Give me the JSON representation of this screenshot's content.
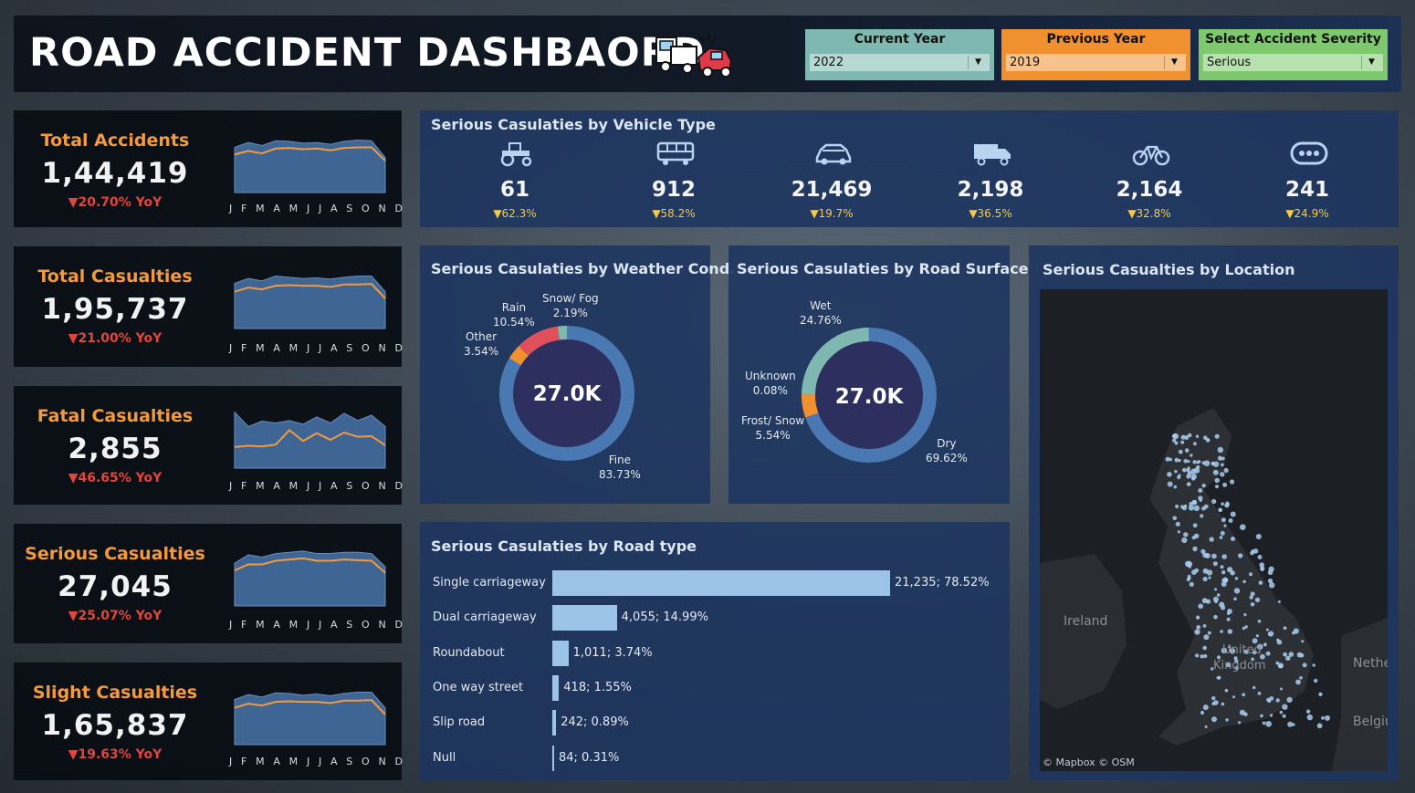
{
  "header": {
    "title": "ROAD ACCIDENT DASHBAORD",
    "filters": [
      {
        "label": "Current Year",
        "value": "2022",
        "color": "#7fb8b0"
      },
      {
        "label": "Previous Year",
        "value": "2019",
        "color": "#f0902f"
      },
      {
        "label": "Select Accident Severity",
        "value": "Serious",
        "color": "#7ec86d"
      }
    ]
  },
  "months": [
    "J",
    "F",
    "M",
    "A",
    "M",
    "J",
    "J",
    "A",
    "S",
    "O",
    "N",
    "D"
  ],
  "kpis": [
    {
      "title": "Total Accidents",
      "value": "1,44,419",
      "yoy": "▼20.70% YoY",
      "area": [
        0.72,
        0.8,
        0.75,
        0.83,
        0.82,
        0.79,
        0.8,
        0.77,
        0.82,
        0.84,
        0.83,
        0.55
      ],
      "line": [
        0.6,
        0.66,
        0.62,
        0.7,
        0.71,
        0.69,
        0.7,
        0.67,
        0.71,
        0.72,
        0.72,
        0.5
      ]
    },
    {
      "title": "Total Casualties",
      "value": "1,95,737",
      "yoy": "▼21.00% YoY",
      "area": [
        0.72,
        0.8,
        0.76,
        0.84,
        0.82,
        0.8,
        0.81,
        0.79,
        0.82,
        0.84,
        0.84,
        0.58
      ],
      "line": [
        0.58,
        0.65,
        0.62,
        0.68,
        0.69,
        0.68,
        0.68,
        0.66,
        0.7,
        0.7,
        0.71,
        0.47
      ]
    },
    {
      "title": "Fatal Casualties",
      "value": "2,855",
      "yoy": "▼46.65% YoY",
      "area": [
        0.9,
        0.66,
        0.75,
        0.72,
        0.76,
        0.7,
        0.82,
        0.72,
        0.88,
        0.76,
        0.85,
        0.66
      ],
      "line": [
        0.32,
        0.34,
        0.33,
        0.36,
        0.6,
        0.42,
        0.55,
        0.44,
        0.56,
        0.49,
        0.5,
        0.35
      ]
    },
    {
      "title": "Serious Casualties",
      "value": "27,045",
      "yoy": "▼25.07% YoY",
      "area": [
        0.68,
        0.82,
        0.78,
        0.84,
        0.86,
        0.88,
        0.84,
        0.84,
        0.86,
        0.86,
        0.84,
        0.62
      ],
      "line": [
        0.56,
        0.66,
        0.66,
        0.72,
        0.74,
        0.76,
        0.72,
        0.72,
        0.74,
        0.73,
        0.72,
        0.52
      ]
    },
    {
      "title": "Slight Casualties",
      "value": "1,65,837",
      "yoy": "▼19.63% YoY",
      "area": [
        0.72,
        0.8,
        0.76,
        0.83,
        0.82,
        0.79,
        0.81,
        0.78,
        0.82,
        0.84,
        0.84,
        0.58
      ],
      "line": [
        0.58,
        0.65,
        0.62,
        0.68,
        0.69,
        0.68,
        0.68,
        0.66,
        0.7,
        0.7,
        0.71,
        0.47
      ]
    }
  ],
  "vehicle": {
    "title": "Serious Casulaties by Vehicle Type",
    "items": [
      {
        "icon": "tractor-icon",
        "value": "61",
        "pct": "▼62.3%"
      },
      {
        "icon": "bus-icon",
        "value": "912",
        "pct": "▼58.2%"
      },
      {
        "icon": "car-icon",
        "value": "21,469",
        "pct": "▼19.7%"
      },
      {
        "icon": "truck-icon",
        "value": "2,198",
        "pct": "▼36.5%"
      },
      {
        "icon": "bicycle-icon",
        "value": "2,164",
        "pct": "▼32.8%"
      },
      {
        "icon": "more-icon",
        "value": "241",
        "pct": "▼24.9%"
      }
    ]
  },
  "weather": {
    "title": "Serious Casulaties by Weather Cond.",
    "center": "27.0K",
    "labels": [
      {
        "name": "Rain",
        "pct": "10.54%"
      },
      {
        "name": "Snow/ Fog",
        "pct": "2.19%"
      },
      {
        "name": "Other",
        "pct": "3.54%"
      },
      {
        "name": "Fine",
        "pct": "83.73%"
      }
    ]
  },
  "surface": {
    "title": "Serious Casulaties by Road Surface",
    "center": "27.0K",
    "labels": [
      {
        "name": "Wet",
        "pct": "24.76%"
      },
      {
        "name": "Unknown",
        "pct": "0.08%"
      },
      {
        "name": "Frost/ Snow",
        "pct": "5.54%"
      },
      {
        "name": "Dry",
        "pct": "69.62%"
      }
    ]
  },
  "road": {
    "title": "Serious Casulaties by Road type",
    "rows": [
      {
        "name": "Single carriageway",
        "label": "21,235; 78.52%",
        "value": 21235
      },
      {
        "name": "Dual carriageway",
        "label": "4,055; 14.99%",
        "value": 4055
      },
      {
        "name": "Roundabout",
        "label": "1,011; 3.74%",
        "value": 1011
      },
      {
        "name": "One way street",
        "label": "418; 1.55%",
        "value": 418
      },
      {
        "name": "Slip road",
        "label": "242; 0.89%",
        "value": 242
      },
      {
        "name": "Null",
        "label": "84; 0.31%",
        "value": 84
      }
    ]
  },
  "location": {
    "title": "Serious Casualties by Location",
    "labels": [
      "Ireland",
      "United",
      "Kingdom",
      "Nethe",
      "Belgiu"
    ],
    "credit": "© Mapbox © OSM"
  },
  "chart_data": [
    {
      "type": "pie",
      "title": "Serious Casulaties by Weather Cond.",
      "categories": [
        "Fine",
        "Rain",
        "Other",
        "Snow/ Fog"
      ],
      "values": [
        83.73,
        10.54,
        3.54,
        2.19
      ]
    },
    {
      "type": "pie",
      "title": "Serious Casulaties by Road Surface",
      "categories": [
        "Dry",
        "Wet",
        "Frost/ Snow",
        "Unknown"
      ],
      "values": [
        69.62,
        24.76,
        5.54,
        0.08
      ]
    },
    {
      "type": "bar",
      "title": "Serious Casulaties by Road type",
      "categories": [
        "Single carriageway",
        "Dual carriageway",
        "Roundabout",
        "One way street",
        "Slip road",
        "Null"
      ],
      "values": [
        21235,
        4055,
        1011,
        418,
        242,
        84
      ]
    }
  ]
}
